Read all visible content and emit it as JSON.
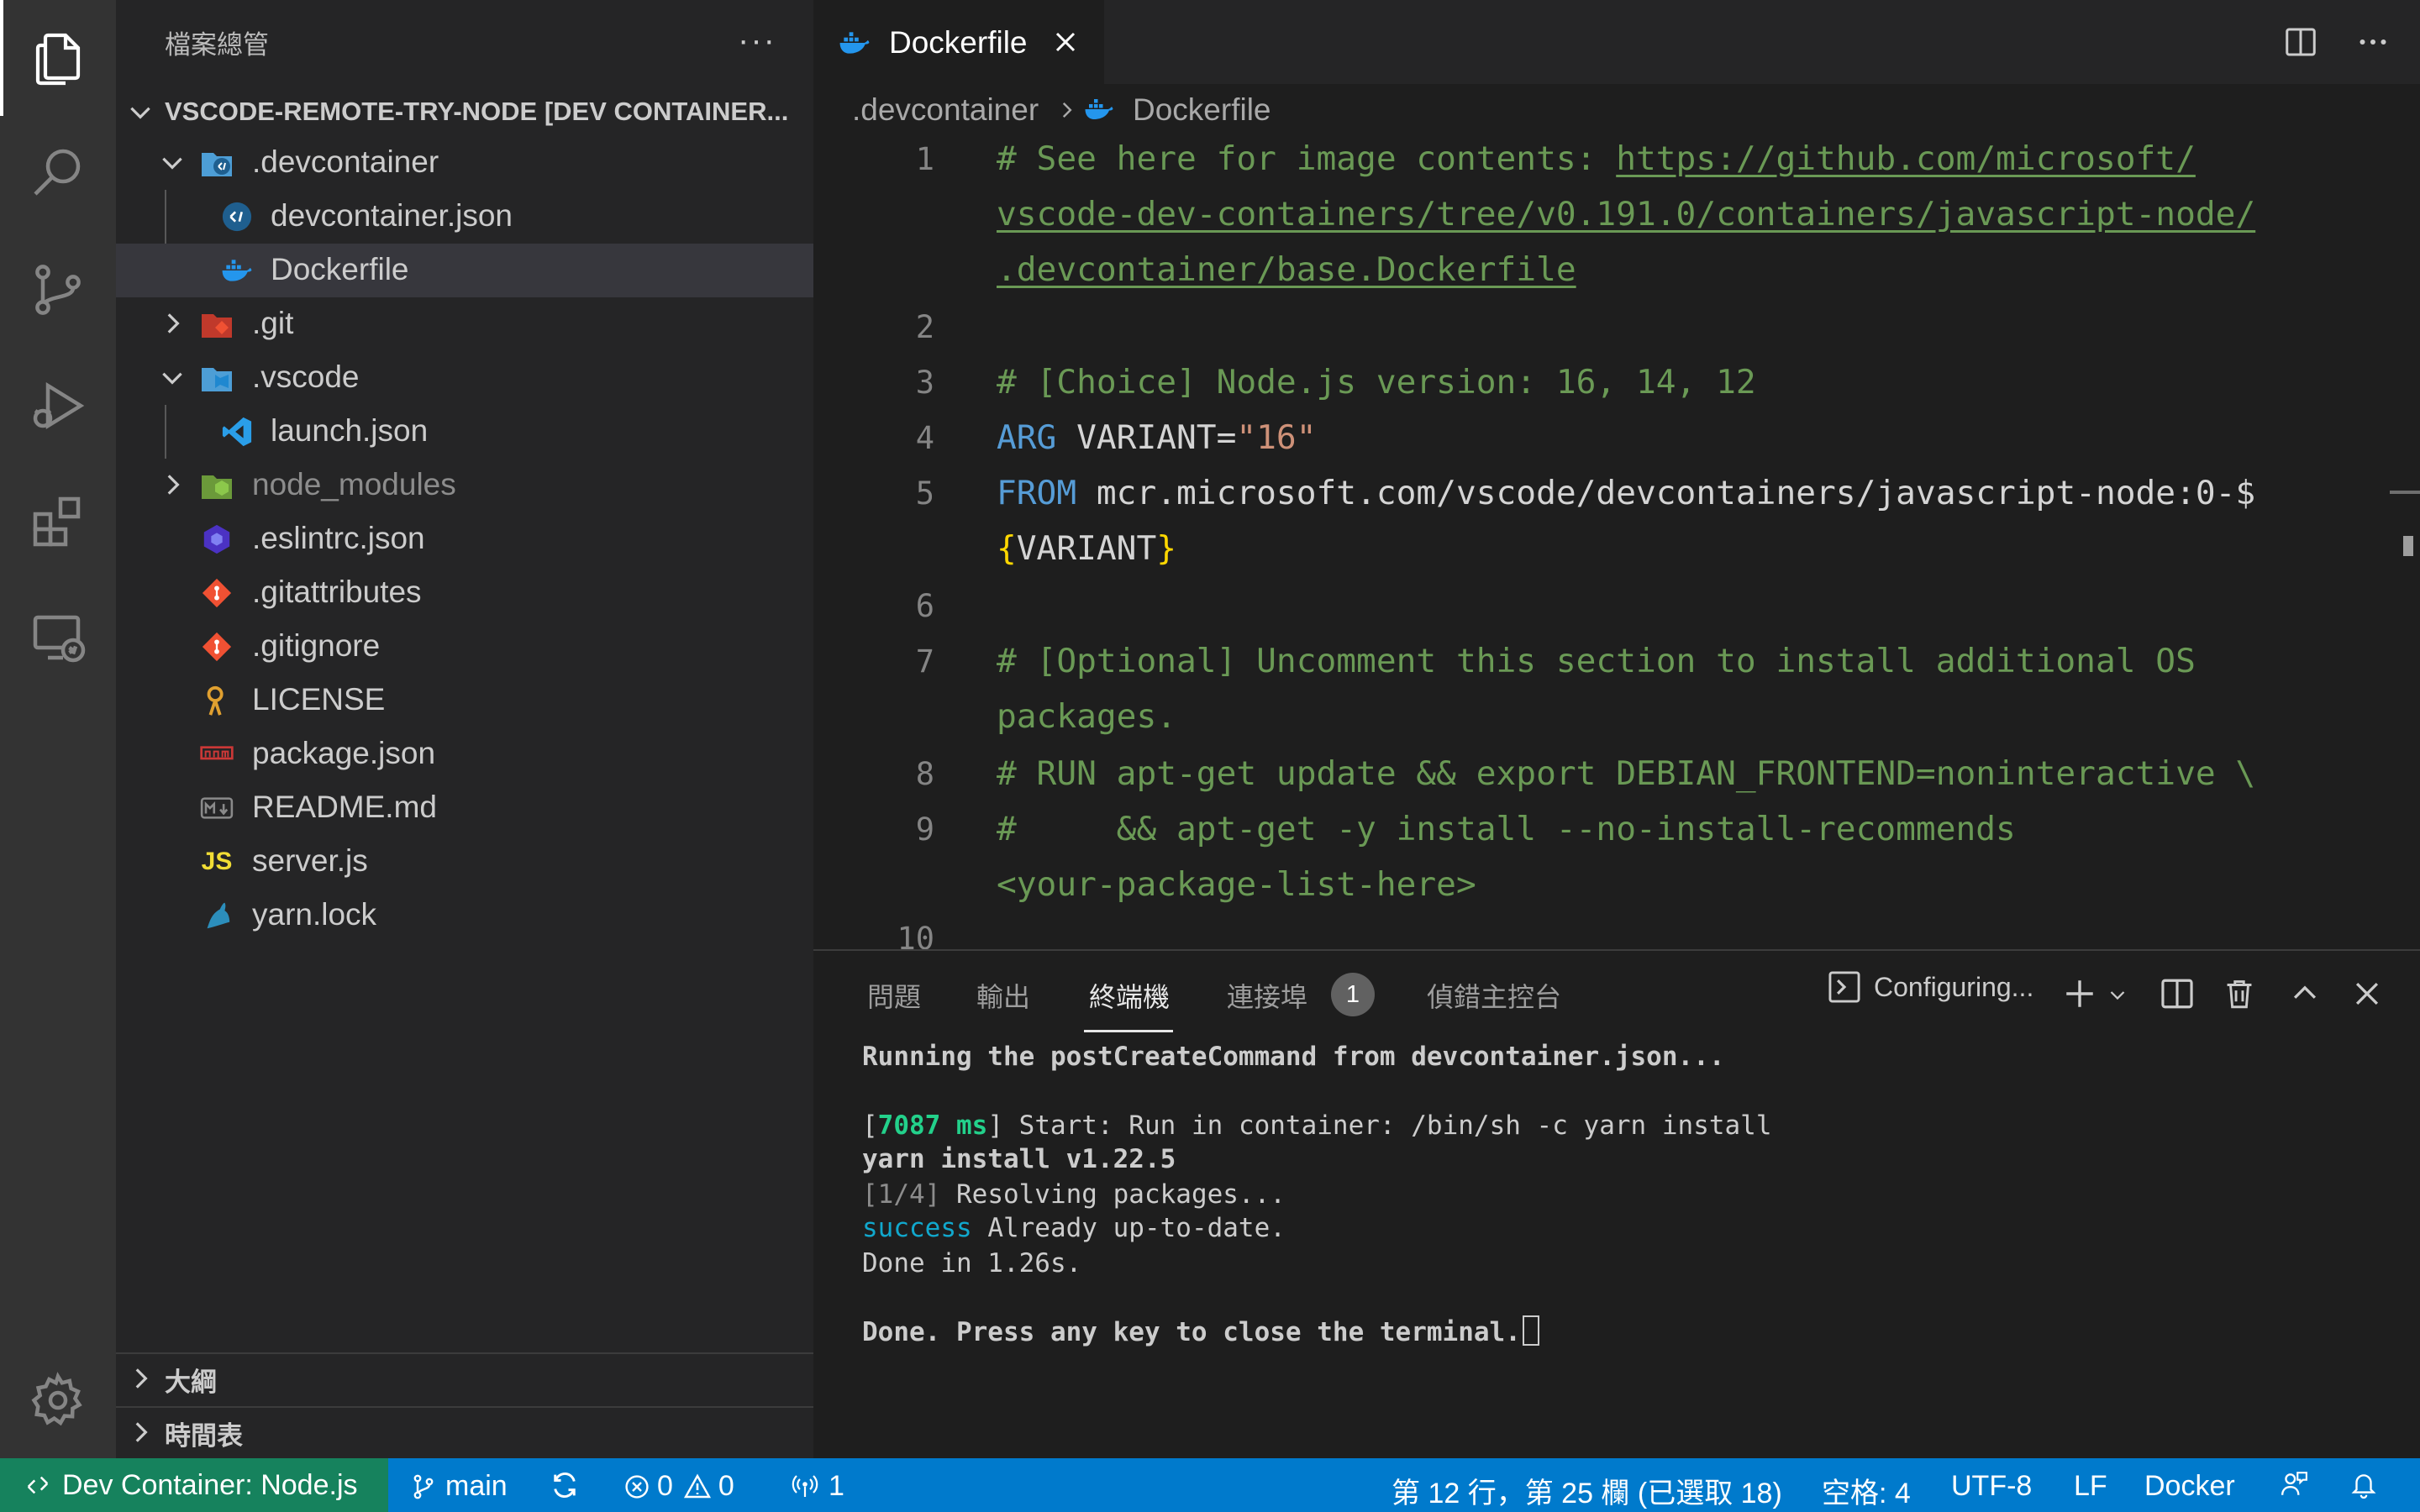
{
  "sidebar": {
    "title": "檔案總管",
    "root_label": "VSCODE-REMOTE-TRY-NODE [DEV CONTAINER...",
    "items": [
      {
        "label": ".devcontainer"
      },
      {
        "label": "devcontainer.json"
      },
      {
        "label": "Dockerfile"
      },
      {
        "label": ".git"
      },
      {
        "label": ".vscode"
      },
      {
        "label": "launch.json"
      },
      {
        "label": "node_modules"
      },
      {
        "label": ".eslintrc.json"
      },
      {
        "label": ".gitattributes"
      },
      {
        "label": ".gitignore"
      },
      {
        "label": "LICENSE"
      },
      {
        "label": "package.json"
      },
      {
        "label": "README.md"
      },
      {
        "label": "server.js"
      },
      {
        "label": "yarn.lock"
      }
    ],
    "outline_label": "大綱",
    "timeline_label": "時間表"
  },
  "editor": {
    "tab_label": "Dockerfile",
    "breadcrumb": [
      ".devcontainer",
      "Dockerfile"
    ],
    "line_numbers": [
      "1",
      "2",
      "3",
      "4",
      "5",
      "6",
      "7",
      "8",
      "9",
      "10"
    ],
    "lines": {
      "l1_comment": "# See here for image contents: ",
      "l1_link_a": "https://github.com/microsoft/",
      "l1_link_b": "vscode-dev-containers/tree/v0.191.0/containers/javascript-node/",
      "l1_link_c": ".devcontainer/base.Dockerfile",
      "l3": "# [Choice] Node.js version: 16, 14, 12",
      "l4_kw": "ARG",
      "l4_var": " VARIANT=",
      "l4_str": "\"16\"",
      "l5_kw": "FROM",
      "l5_rest": " mcr.microsoft.com/vscode/devcontainers/javascript-node:0-$",
      "l5_open": "{",
      "l5_var": "VARIANT",
      "l5_close": "}",
      "l7a": "# [Optional] Uncomment this section to install additional OS ",
      "l7b": "packages.",
      "l8": "# RUN apt-get update && export DEBIAN_FRONTEND=noninteractive \\",
      "l9a": "#     && apt-get -y install --no-install-recommends ",
      "l9b": "<your-package-list-here>"
    }
  },
  "panel": {
    "tabs": [
      "問題",
      "輸出",
      "終端機",
      "連接埠"
    ],
    "extra_tab": "偵錯主控台",
    "ports_badge": "1",
    "terminal_name": "Configuring...",
    "terminal": {
      "line1": "Running the postCreateCommand from devcontainer.json...",
      "line2_open": "[",
      "line2_ms": "7087 ms",
      "line2_rest": "] Start: Run in container: /bin/sh -c yarn install",
      "line3": "yarn install v1.22.5",
      "line4_step": "[1/4]",
      "line4_rest": " Resolving packages...",
      "line5_success": "success",
      "line5_rest": " Already up-to-date.",
      "line6": "Done in 1.26s.",
      "line7": "Done. Press any key to close the terminal."
    }
  },
  "statusbar": {
    "remote": "Dev Container: Node.js",
    "branch": "main",
    "errors": "0",
    "warnings": "0",
    "ports": "1",
    "position": "第 12 行，第 25 欄 (已選取 18)",
    "spaces": "空格: 4",
    "encoding": "UTF-8",
    "eol": "LF",
    "language": "Docker"
  },
  "colors": {
    "statusbar": "#007acc",
    "remote_indicator": "#16825d",
    "comment": "#6a9955",
    "keyword": "#569cd6",
    "string": "#ce9178"
  }
}
